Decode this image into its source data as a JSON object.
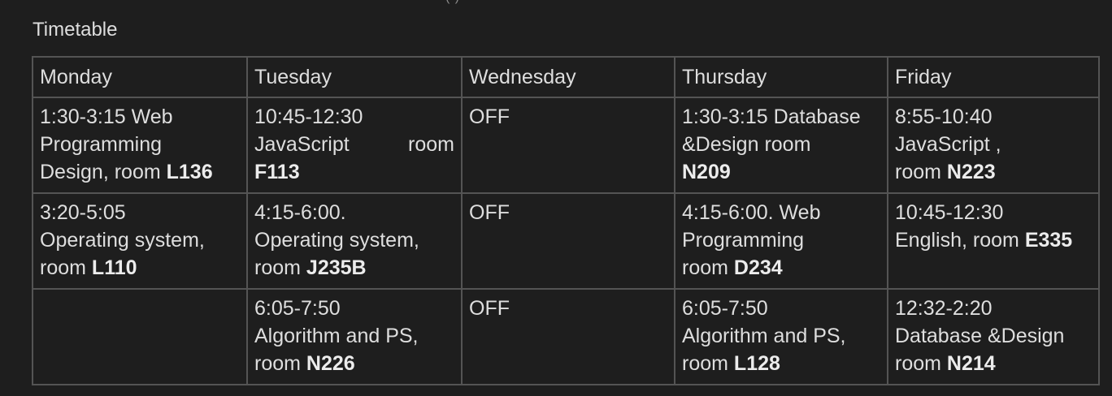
{
  "page": {
    "top_fragment": "(  )",
    "title": "Timetable"
  },
  "table": {
    "headers": [
      "Monday",
      "Tuesday",
      "Wednesday",
      "Thursday",
      "Friday"
    ],
    "rows": [
      [
        {
          "time": "1:30-3:15 Web",
          "text": "Programming",
          "text2": "Design, room",
          "room": "L136"
        },
        {
          "time": "10:45-12:30",
          "text_a": "JavaScript",
          "text_b": "room",
          "room": "F113"
        },
        {
          "text": "OFF"
        },
        {
          "time": "1:30-3:15 Database",
          "text": "&Design room",
          "room": "N209"
        },
        {
          "time": "8:55-10:40",
          "text": "JavaScript ,",
          "text2": "room",
          "room": "N223"
        }
      ],
      [
        {
          "time": "3:20-5:05",
          "text": "Operating system,",
          "text2": "room",
          "room": "L110"
        },
        {
          "time": "4:15-6:00.",
          "text": "Operating system,",
          "text2": "room",
          "room": "J235B"
        },
        {
          "text": "OFF"
        },
        {
          "time": "4:15-6:00. Web",
          "text": "Programming",
          "text2": "room",
          "room": "D234"
        },
        {
          "time": "10:45-12:30",
          "text2": "English, room",
          "room": "E335"
        }
      ],
      [
        {
          "text": ""
        },
        {
          "time": "6:05-7:50",
          "text": "Algorithm and PS,",
          "text2": "room",
          "room": "N226"
        },
        {
          "text": "OFF"
        },
        {
          "time": "6:05-7:50",
          "text": "Algorithm and PS,",
          "text2": "room",
          "room": "L128"
        },
        {
          "time": "12:32-2:20",
          "text": "Database &Design",
          "text2": "room",
          "room": "N214"
        }
      ]
    ]
  }
}
